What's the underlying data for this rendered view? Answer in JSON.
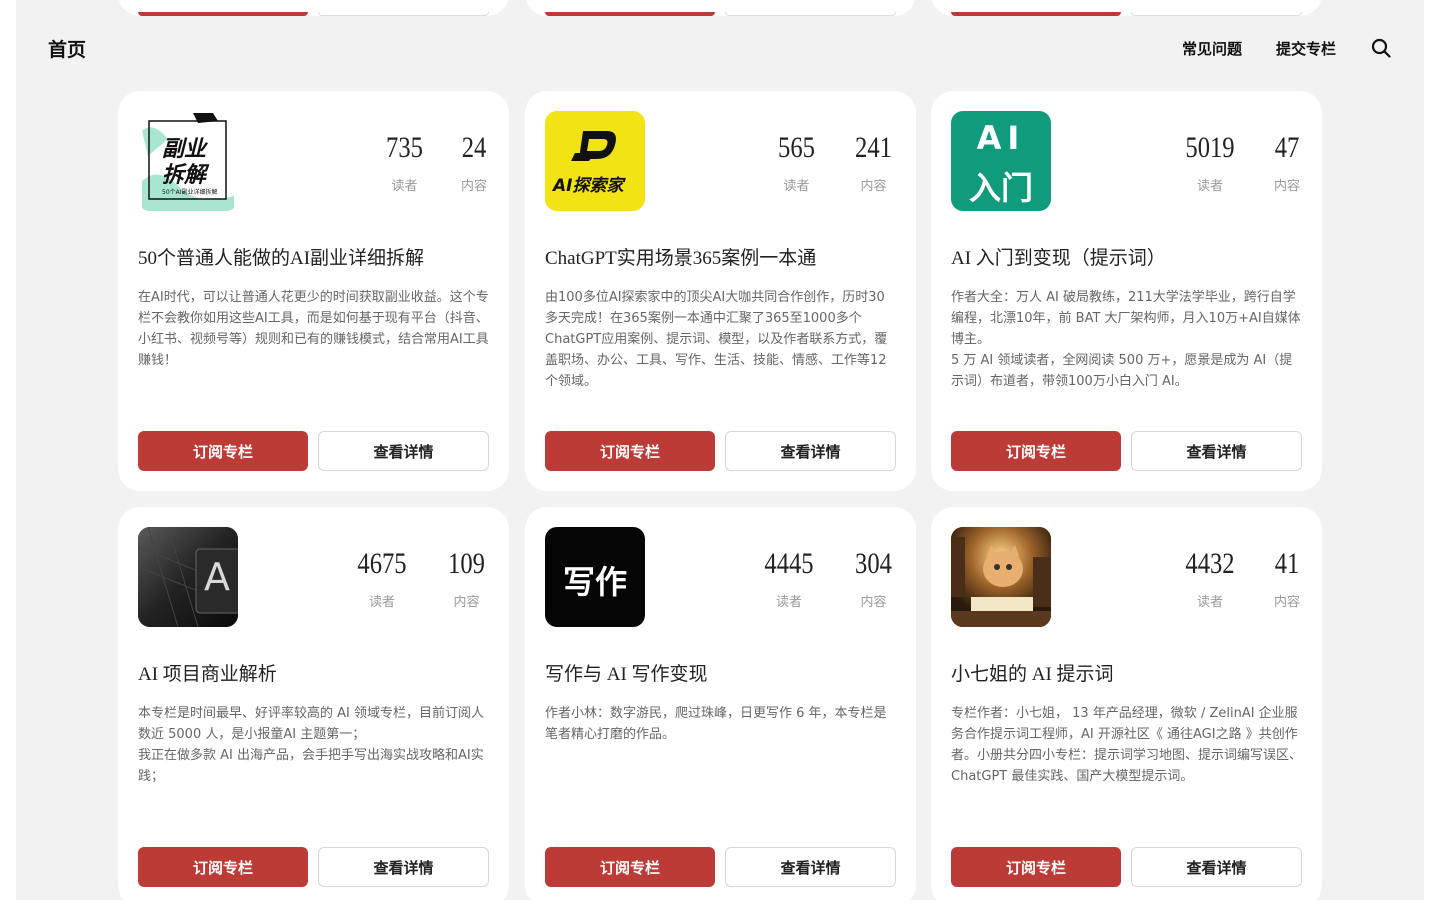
{
  "nav": {
    "home": "首页",
    "faq": "常见问题",
    "submit": "提交专栏"
  },
  "colors": {
    "accent": "#bd3b36",
    "page_bg": "#f2f2f2",
    "card_bg": "#ffffff"
  },
  "cards": [
    {
      "cover_icon": "side-hustle-cover",
      "cover_text": [
        "副业",
        "拆解"
      ],
      "cover_small": "50个AI副业详细拆解",
      "readers": "735",
      "contents": "24",
      "readers_label": "读者",
      "contents_label": "内容",
      "title": "50个普通人能做的AI副业详细拆解",
      "desc": "在AI时代，可以让普通人花更少的时间获取副业收益。这个专栏不会教你如用这些AI工具，而是如何基于现有平台（抖音、小红书、视频号等）规则和已有的赚钱模式，结合常用AI工具赚钱！",
      "subscribe": "订阅专栏",
      "detail": "查看详情"
    },
    {
      "cover_icon": "ai-explorer-cover",
      "cover_text": [
        "AI探索家"
      ],
      "readers": "565",
      "contents": "241",
      "readers_label": "读者",
      "contents_label": "内容",
      "title": "ChatGPT实用场景365案例一本通",
      "desc": "由100多位AI探索家中的顶尖AI大咖共同合作创作，历时30多天完成！在365案例一本通中汇聚了365至1000多个ChatGPT应用案例、提示词、模型，以及作者联系方式，覆盖职场、办公、工具、写作、生活、技能、情感、工作等12个领域。",
      "subscribe": "订阅专栏",
      "detail": "查看详情"
    },
    {
      "cover_icon": "ai-intro-cover",
      "cover_text": [
        "AI",
        "入门"
      ],
      "readers": "5019",
      "contents": "47",
      "readers_label": "读者",
      "contents_label": "内容",
      "title": "AI 入门到变现（提示词）",
      "desc": "作者大全：万人 AI 破局教练，211大学法学毕业，跨行自学编程，北漂10年，前 BAT 大厂架构师，月入10万+AI自媒体博主。\n5 万 AI 领域读者，全网阅读 500 万+，愿景是成为 AI（提示词）布道者，带领100万小白入门 AI。",
      "subscribe": "订阅专栏",
      "detail": "查看详情"
    },
    {
      "cover_icon": "ai-project-cover",
      "cover_text": [
        "A"
      ],
      "readers": "4675",
      "contents": "109",
      "readers_label": "读者",
      "contents_label": "内容",
      "title": "AI 项目商业解析",
      "desc": "本专栏是时间最早、好评率较高的 AI 领域专栏，目前订阅人数近 5000 人，是小报童AI 主题第一；\n我正在做多款 AI 出海产品，会手把手写出海实战攻略和AI实践；",
      "subscribe": "订阅专栏",
      "detail": "查看详情"
    },
    {
      "cover_icon": "writing-cover",
      "cover_text": [
        "写作"
      ],
      "readers": "4445",
      "contents": "304",
      "readers_label": "读者",
      "contents_label": "内容",
      "title": "写作与 AI 写作变现",
      "desc": "作者小林：数字游民，爬过珠峰，日更写作 6 年，本专栏是笔者精心打磨的作品。",
      "subscribe": "订阅专栏",
      "detail": "查看详情"
    },
    {
      "cover_icon": "cat-reading-cover",
      "cover_text": [],
      "readers": "4432",
      "contents": "41",
      "readers_label": "读者",
      "contents_label": "内容",
      "title": "小七姐的 AI 提示词",
      "desc": "专栏作者：小七姐， 13 年产品经理，微软 / ZelinAI 企业服务合作提示词工程师，AI 开源社区《 通往AGI之路 》共创作者。小册共分四小专栏：提示词学习地图、提示词编写误区、ChatGPT 最佳实践、国产大模型提示词。",
      "subscribe": "订阅专栏",
      "detail": "查看详情"
    }
  ]
}
